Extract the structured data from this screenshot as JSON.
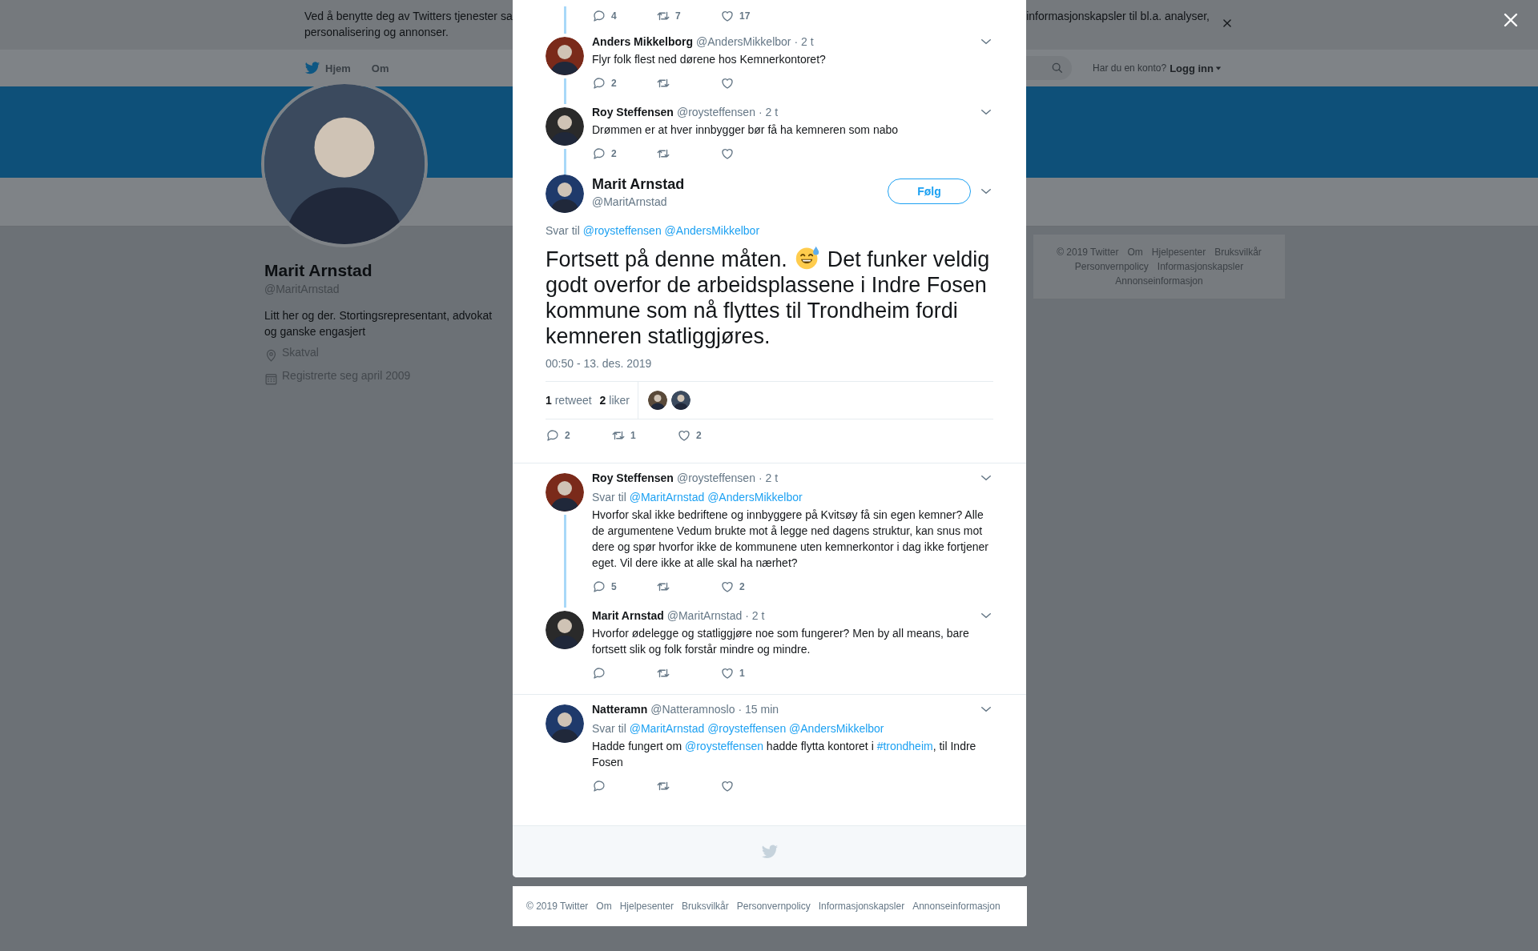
{
  "cookie_banner": {
    "fragments": [
      "Ved å benytte deg av Twitters tjenester sa",
      "informasjonskapsler til bl.a. analyser,",
      "personalisering og annonser."
    ]
  },
  "nav": {
    "items": [
      {
        "label": "Hjem",
        "kind": "home"
      },
      {
        "label": "Om",
        "kind": "plain"
      }
    ],
    "account_prompt": "Har du en konto?",
    "login": "Logg inn"
  },
  "profile": {
    "name": "Marit Arnstad",
    "handle": "@MaritArnstad",
    "bio": "Litt her og der. Stortingsrepresentant, advokat og ganske engasjert",
    "location": "Skatval",
    "joined": "Registrerte seg april 2009"
  },
  "side_footer": {
    "links": [
      "© 2019 Twitter",
      "Om",
      "Hjelpesenter",
      "Bruksvilkår",
      "Personvernpolicy",
      "Informasjonskapsler",
      "Annonseinformasjon"
    ]
  },
  "modal": {
    "thread": [
      {
        "kind": "actions_only",
        "thread_line": true,
        "actions": {
          "replies": "4",
          "retweets": "7",
          "likes": "17"
        }
      },
      {
        "kind": "tweet",
        "name": "Anders Mikkelborg",
        "handle": "@AndersMikkelbor",
        "time": "· 2 t",
        "thread_line": true,
        "text": [
          {
            "kind": "plain",
            "text": "Flyr folk flest ned dørene hos Kemnerkontoret?"
          }
        ],
        "actions": {
          "replies": "2"
        }
      },
      {
        "kind": "tweet",
        "name": "Roy Steffensen",
        "handle": "@roysteffensen",
        "time": "· 2 t",
        "thread_line": true,
        "text": [
          {
            "kind": "plain",
            "text": "Drømmen er at hver innbygger bør få ha kemneren som nabo"
          }
        ],
        "actions": {
          "replies": "2"
        }
      }
    ],
    "main_tweet": {
      "name": "Marit Arnstad",
      "handle": "@MaritArnstad",
      "follow_button": "Følg",
      "reply_label": "Svar til",
      "reply_to": [
        "@roysteffensen",
        "@AndersMikkelbor"
      ],
      "text_before": "Fortsett på denne måten.",
      "text_after": "Det funker veldig godt overfor de arbeidsplassene i Indre Fosen kommune som nå flyttes til Trondheim fordi kemneren statliggjøres.",
      "timestamp": "00:50 - 13. des. 2019",
      "stats": [
        "**1** retweet",
        "**2** liker"
      ],
      "liked_by": [
        {
          "kind": "picture"
        },
        {
          "kind": "picture"
        }
      ],
      "actions": {
        "replies": "2",
        "retweets": "1",
        "likes": "2"
      }
    },
    "reply_groups": [
      [
        {
          "kind": "tweet",
          "name": "Roy Steffensen",
          "handle": "@roysteffensen",
          "time": "· 2 t",
          "thread_line": true,
          "reply_label": "Svar til",
          "reply_to": [
            "@MaritArnstad",
            "@AndersMikkelbor"
          ],
          "text": [
            {
              "kind": "plain",
              "text": "Hvorfor skal ikke bedriftene og innbyggere på Kvitsøy få sin egen kemner? Alle de argumentene Vedum brukte mot å legge ned dagens struktur, kan snus mot dere og spør hvorfor ikke de kommunene uten kemnerkontor i dag ikke fortjener eget. Vil dere ikke at alle skal ha nærhet?"
            }
          ],
          "actions": {
            "replies": "5",
            "likes": "2"
          }
        },
        {
          "kind": "tweet",
          "name": "Marit Arnstad",
          "handle": "@MaritArnstad",
          "time": "· 2 t",
          "thread_line": false,
          "text": [
            {
              "kind": "plain",
              "text": "Hvorfor ødelegge og statliggjøre noe som fungerer? Men by all means, bare fortsett slik og folk forstår mindre og mindre."
            }
          ],
          "actions": {
            "likes": "1"
          }
        }
      ],
      [
        {
          "kind": "tweet",
          "name": "Natteramn",
          "handle": "@Natteramnoslo",
          "time": "· 15 min",
          "thread_line": false,
          "reply_label": "Svar til",
          "reply_to": [
            "@MaritArnstad",
            "@roysteffensen",
            "@AndersMikkelbor"
          ],
          "text": [
            {
              "kind": "plain",
              "text": "Hadde fungert om "
            },
            {
              "kind": "mention",
              "text": "@roysteffensen"
            },
            {
              "kind": "plain",
              "text": " hadde flytta kontoret i "
            },
            {
              "kind": "hashtag",
              "text": "#trondheim"
            },
            {
              "kind": "plain",
              "text": ", til Indre Fosen"
            }
          ]
        }
      ]
    ]
  },
  "bottom_footer": {
    "links": [
      "© 2019 Twitter",
      "Om",
      "Hjelpesenter",
      "Bruksvilkår",
      "Personvernpolicy",
      "Informasjonskapsler",
      "Annonseinformasjon"
    ]
  }
}
